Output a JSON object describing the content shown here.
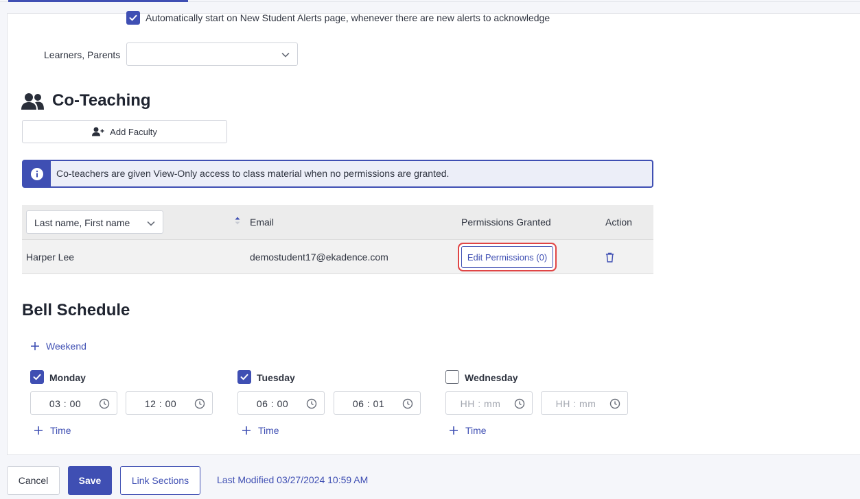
{
  "alerts": {
    "auto_start_checked": true,
    "auto_start_label": "Automatically start on New Student Alerts page, whenever there are new alerts to acknowledge",
    "learners_parents_label": "Learners, Parents",
    "learners_parents_value": ""
  },
  "coteaching": {
    "title": "Co-Teaching",
    "add_faculty_label": "Add Faculty",
    "info_text": "Co-teachers are given View-Only access to class material when no permissions are granted.",
    "table": {
      "sort_select": "Last name, First name",
      "columns": [
        "Email",
        "Permissions Granted",
        "Action"
      ],
      "rows": [
        {
          "name": "Harper Lee",
          "email": "demostudent17@ekadence.com",
          "permissions_button": "Edit Permissions (0)"
        }
      ]
    }
  },
  "bell_schedule": {
    "title": "Bell Schedule",
    "weekend_label": "Weekend",
    "add_time_label": "Time",
    "days": [
      {
        "name": "Monday",
        "checked": true,
        "start": "03 : 00",
        "end": "12 : 00"
      },
      {
        "name": "Tuesday",
        "checked": true,
        "start": "06 : 00",
        "end": "06 : 01"
      },
      {
        "name": "Wednesday",
        "checked": false,
        "start": "HH : mm",
        "end": "HH : mm"
      }
    ]
  },
  "footer": {
    "cancel_label": "Cancel",
    "save_label": "Save",
    "link_sections_label": "Link Sections",
    "last_modified": "Last Modified 03/27/2024 10:59 AM"
  },
  "colors": {
    "accent": "#3f4fb3",
    "highlight_border": "#e04545"
  },
  "icons": [
    "check-icon",
    "chevron-down-icon",
    "users-icon",
    "user-plus-icon",
    "info-icon",
    "sort-icon",
    "trash-icon",
    "plus-icon",
    "clock-icon"
  ]
}
